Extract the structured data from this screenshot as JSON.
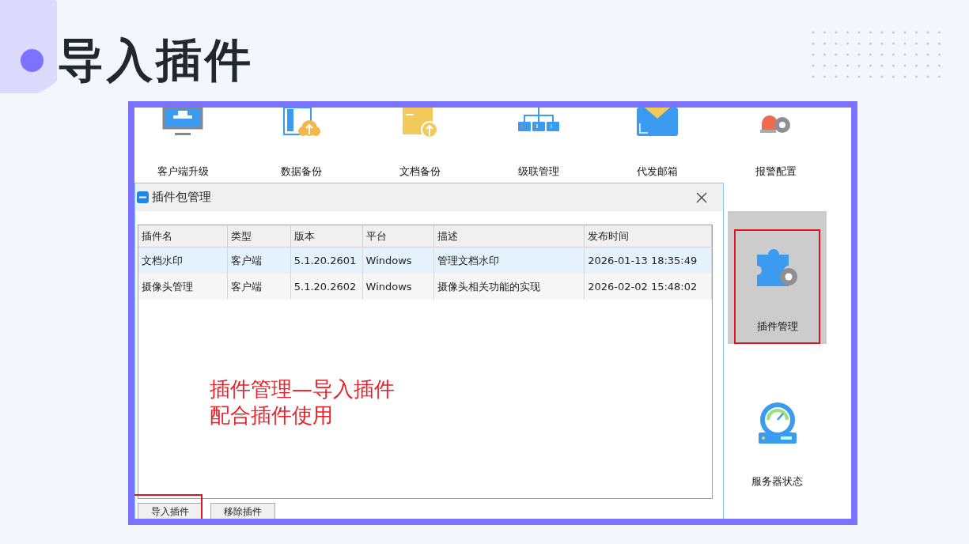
{
  "slide": {
    "title": "导入插件"
  },
  "app_icons": [
    {
      "label": "客户端升级"
    },
    {
      "label": "数据备份"
    },
    {
      "label": "文档备份"
    },
    {
      "label": "级联管理"
    },
    {
      "label": "代发邮箱"
    },
    {
      "label": "报警配置"
    }
  ],
  "side_icons": [
    {
      "label": "插件管理",
      "selected": true
    },
    {
      "label": "服务器状态",
      "selected": false
    }
  ],
  "dialog": {
    "title": "插件包管理",
    "table": {
      "columns": [
        "插件名",
        "类型",
        "版本",
        "平台",
        "描述",
        "发布时间"
      ],
      "rows": [
        {
          "cells": [
            "文档水印",
            "客户端",
            "5.1.20.2601",
            "Windows",
            "管理文档水印",
            "2026-01-13 18:35:49"
          ],
          "selected": true
        },
        {
          "cells": [
            "摄像头管理",
            "客户端",
            "5.1.20.2602",
            "Windows",
            "摄像头相关功能的实现",
            "2026-02-02 15:48:02"
          ],
          "selected": false
        }
      ]
    },
    "buttons": [
      {
        "label": "导入插件",
        "highlighted": true
      },
      {
        "label": "移除插件",
        "highlighted": false
      }
    ]
  },
  "annotation": [
    "插件管理—导入插件",
    "配合插件使用"
  ]
}
